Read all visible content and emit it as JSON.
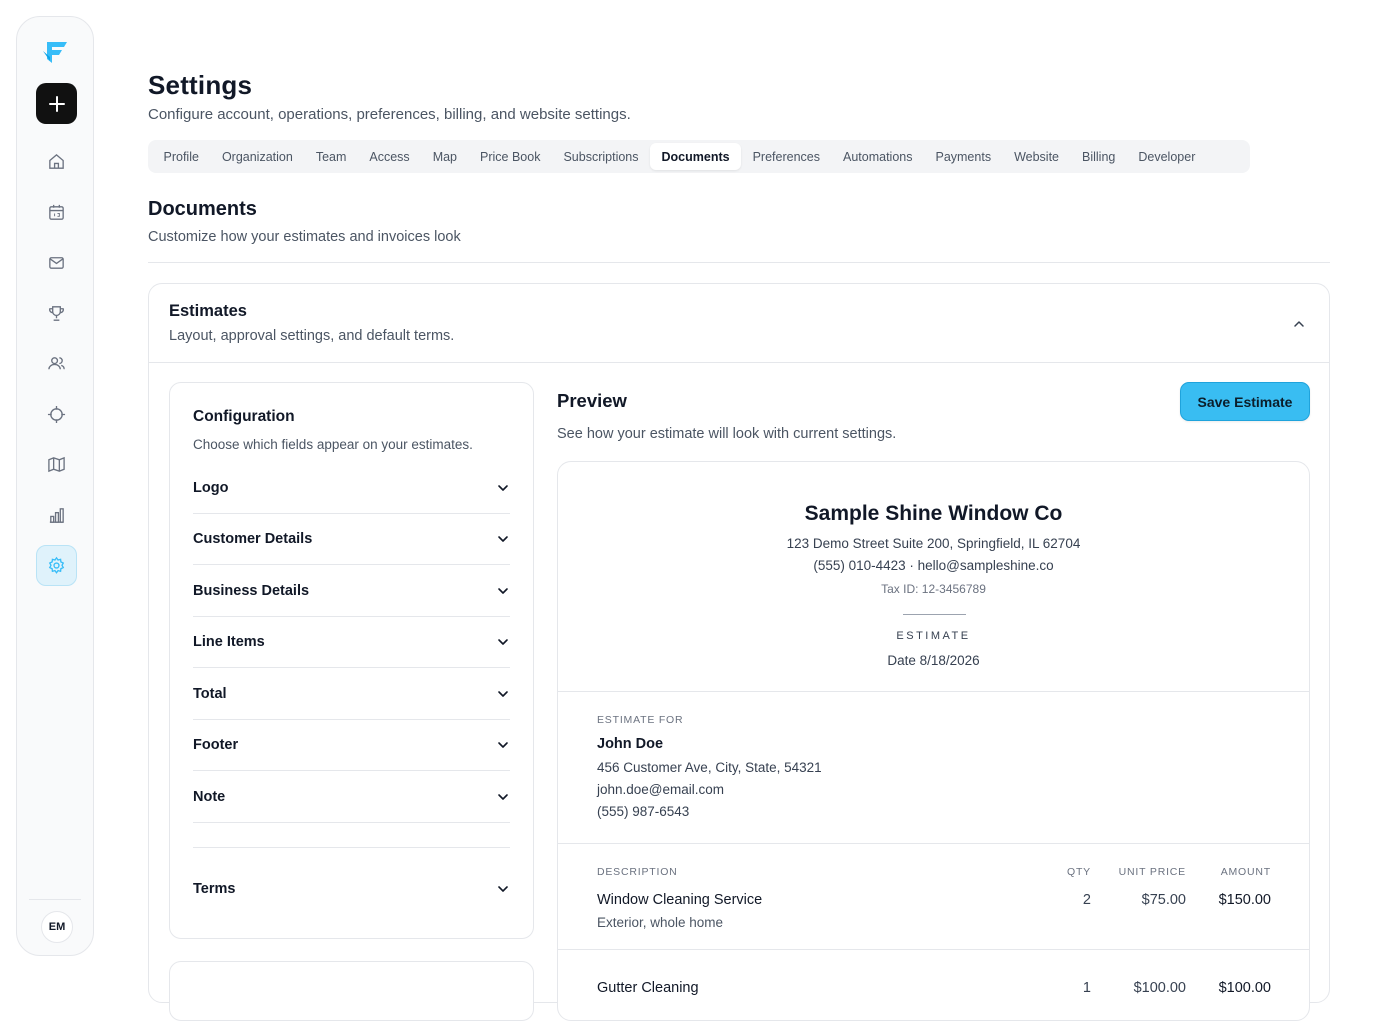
{
  "sidebar": {
    "nav_icons": [
      "home-icon",
      "calendar-icon",
      "mail-icon",
      "trophy-icon",
      "users-icon",
      "crosshair-icon",
      "map-icon",
      "bar-chart-icon",
      "gear-icon"
    ],
    "active": "gear-icon",
    "avatar_initials": "EM"
  },
  "header": {
    "title": "Settings",
    "subtitle": "Configure account, operations, preferences, billing, and website settings."
  },
  "tabs": [
    {
      "label": "Profile"
    },
    {
      "label": "Organization"
    },
    {
      "label": "Team"
    },
    {
      "label": "Access"
    },
    {
      "label": "Map"
    },
    {
      "label": "Price Book"
    },
    {
      "label": "Subscriptions"
    },
    {
      "label": "Documents"
    },
    {
      "label": "Preferences"
    },
    {
      "label": "Automations"
    },
    {
      "label": "Payments"
    },
    {
      "label": "Website"
    },
    {
      "label": "Billing"
    },
    {
      "label": "Developer"
    }
  ],
  "active_tab": "Documents",
  "section": {
    "title": "Documents",
    "subtitle": "Customize how your estimates and invoices look"
  },
  "estimates": {
    "title": "Estimates",
    "subtitle": "Layout, approval settings, and default terms."
  },
  "configuration": {
    "title": "Configuration",
    "subtitle": "Choose which fields appear on your estimates.",
    "fields": [
      "Logo",
      "Customer Details",
      "Business Details",
      "Line Items",
      "Total",
      "Footer",
      "Note"
    ],
    "terms_label": "Terms"
  },
  "preview": {
    "title": "Preview",
    "subtitle": "See how your estimate will look with current settings.",
    "save_label": "Save Estimate"
  },
  "document": {
    "business_name": "Sample Shine Window Co",
    "address": "123 Demo Street Suite 200, Springfield, IL 62704",
    "contact": "(555) 010-4423 · hello@sampleshine.co",
    "tax_id": "Tax ID: 12-3456789",
    "kind": "ESTIMATE",
    "date": "Date 8/18/2026",
    "customer_label": "ESTIMATE FOR",
    "customer": {
      "name": "John Doe",
      "address": "456 Customer Ave, City, State, 54321",
      "email": "john.doe@email.com",
      "phone": "(555) 987-6543"
    },
    "columns": {
      "description": "DESCRIPTION",
      "qty": "QTY",
      "unit_price": "UNIT PRICE",
      "amount": "AMOUNT"
    },
    "items": [
      {
        "name": "Window Cleaning Service",
        "desc": "Exterior, whole home",
        "qty": "2",
        "unit_price": "$75.00",
        "amount": "$150.00"
      },
      {
        "name": "Gutter Cleaning",
        "desc": "",
        "qty": "1",
        "unit_price": "$100.00",
        "amount": "$100.00"
      }
    ]
  },
  "colors": {
    "accent": "#39bdf2",
    "active_nav_bg": "#dff2fb",
    "logo": "#38bdf8"
  }
}
